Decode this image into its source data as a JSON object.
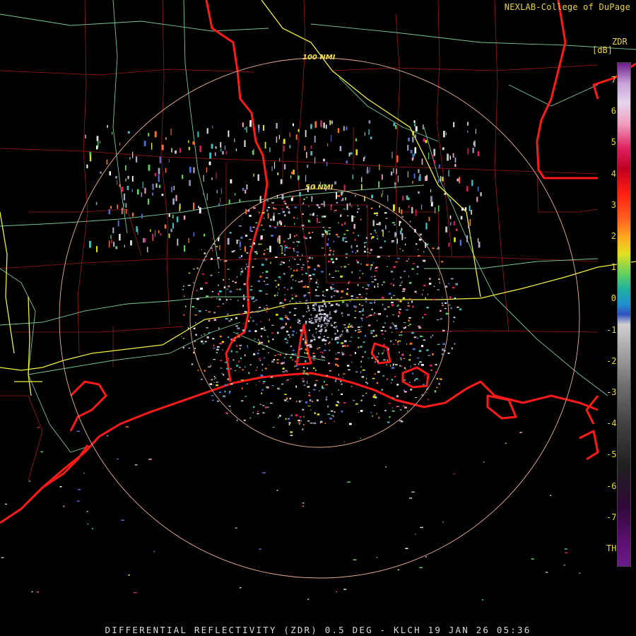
{
  "header": {
    "credit": "NEXLAB-College of DuPage"
  },
  "footer": {
    "caption": "DIFFERENTIAL REFLECTIVITY (ZDR) 0.5 DEG - KLCH 19 JAN 26 05:36"
  },
  "legend": {
    "product": "ZDR",
    "unit": "[dB]",
    "ticks": [
      "7",
      "6",
      "5",
      "4",
      "3",
      "2",
      "1",
      "0",
      "-1",
      "-2",
      "-3",
      "-4",
      "-5",
      "-6",
      "-7",
      "TH"
    ]
  },
  "map": {
    "range_rings": [
      {
        "label": "50 NMI"
      },
      {
        "label": "100 NMI"
      }
    ]
  },
  "colors": {
    "coastline_state": "#ff1a1a",
    "county_lines": "#a01818",
    "highways": "#90e8b0",
    "interstates": "#f0f040",
    "range_ring": "#e8b090",
    "background": "#000000"
  }
}
